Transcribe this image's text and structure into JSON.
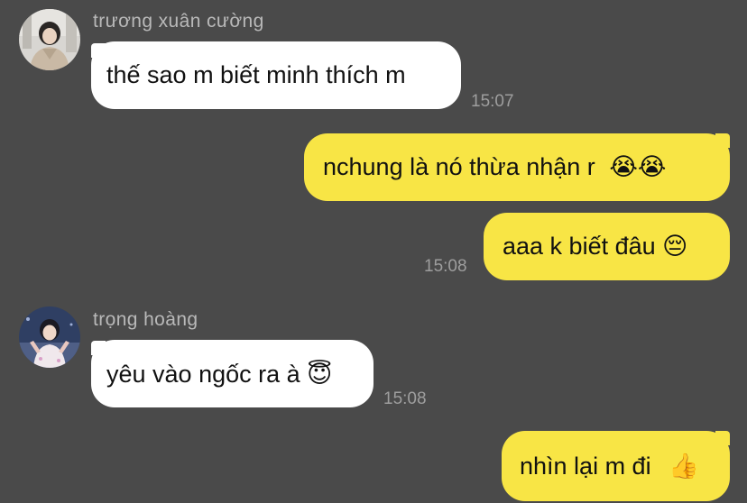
{
  "messages": [
    {
      "sender": "trương xuân cường",
      "text": "thế sao m biết minh thích m",
      "time": "15:07",
      "direction": "incoming"
    },
    {
      "text": "nchung là nó thừa nhận r",
      "emoji": "😭😭",
      "direction": "outgoing"
    },
    {
      "text": "aaa k biết đâu",
      "emoji": "😔",
      "time": "15:08",
      "direction": "outgoing"
    },
    {
      "sender": "trọng hoàng",
      "text": "yêu vào ngốc ra à",
      "emoji": "😇",
      "time": "15:08",
      "direction": "incoming"
    },
    {
      "text": "nhìn lại m đi",
      "emoji": "👍",
      "direction": "outgoing"
    }
  ],
  "colors": {
    "background": "#4a4a4a",
    "incoming_bubble": "#ffffff",
    "outgoing_bubble": "#f8e545",
    "name_text": "#b9b9b9",
    "time_text": "#9e9e9e"
  }
}
